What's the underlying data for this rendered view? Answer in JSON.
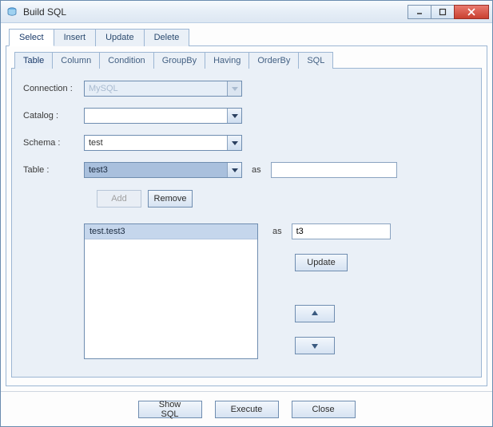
{
  "window": {
    "title": "Build SQL"
  },
  "main_tabs": {
    "select": "Select",
    "insert": "Insert",
    "update": "Update",
    "delete": "Delete"
  },
  "sub_tabs": {
    "table": "Table",
    "column": "Column",
    "condition": "Condition",
    "groupby": "GroupBy",
    "having": "Having",
    "orderby": "OrderBy",
    "sql": "SQL"
  },
  "form": {
    "connection_label": "Connection :",
    "connection_value": "MySQL",
    "catalog_label": "Catalog :",
    "catalog_value": "",
    "schema_label": "Schema :",
    "schema_value": "test",
    "table_label": "Table :",
    "table_value": "test3",
    "as_label": "as",
    "alias_top_value": "",
    "alias_side_value": "t3"
  },
  "buttons": {
    "add": "Add",
    "remove": "Remove",
    "update": "Update",
    "show_sql": "Show SQL",
    "execute": "Execute",
    "close": "Close"
  },
  "list": {
    "items": [
      "test.test3"
    ]
  }
}
